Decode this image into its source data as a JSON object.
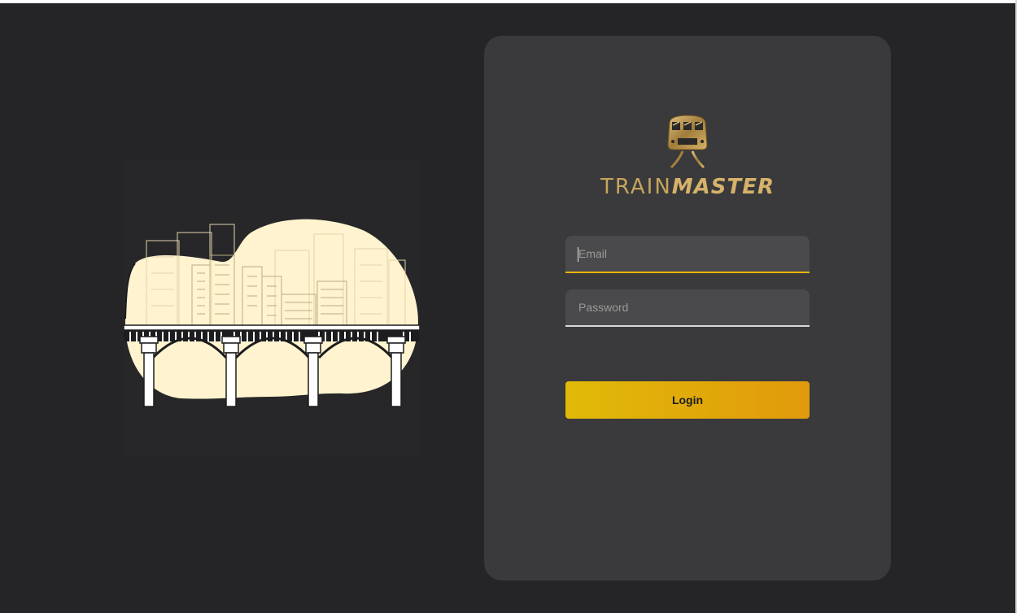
{
  "brand": {
    "name_part1": "TRAIN",
    "name_part2": "MASTER",
    "logo_icon": "train-front-icon",
    "logo_color": "#c8a45c"
  },
  "illustration": {
    "subject": "city-bridge-illustration",
    "blob_color": "#fff4cf"
  },
  "login_form": {
    "email_placeholder": "Email",
    "email_value": "",
    "password_placeholder": "Password",
    "password_value": "",
    "login_label": "Login"
  },
  "colors": {
    "page_background": "#252527",
    "card_background": "#3a3a3c",
    "accent_start": "#e1ba08",
    "accent_end": "#e19a0c",
    "input_background": "#4a4a4c"
  }
}
